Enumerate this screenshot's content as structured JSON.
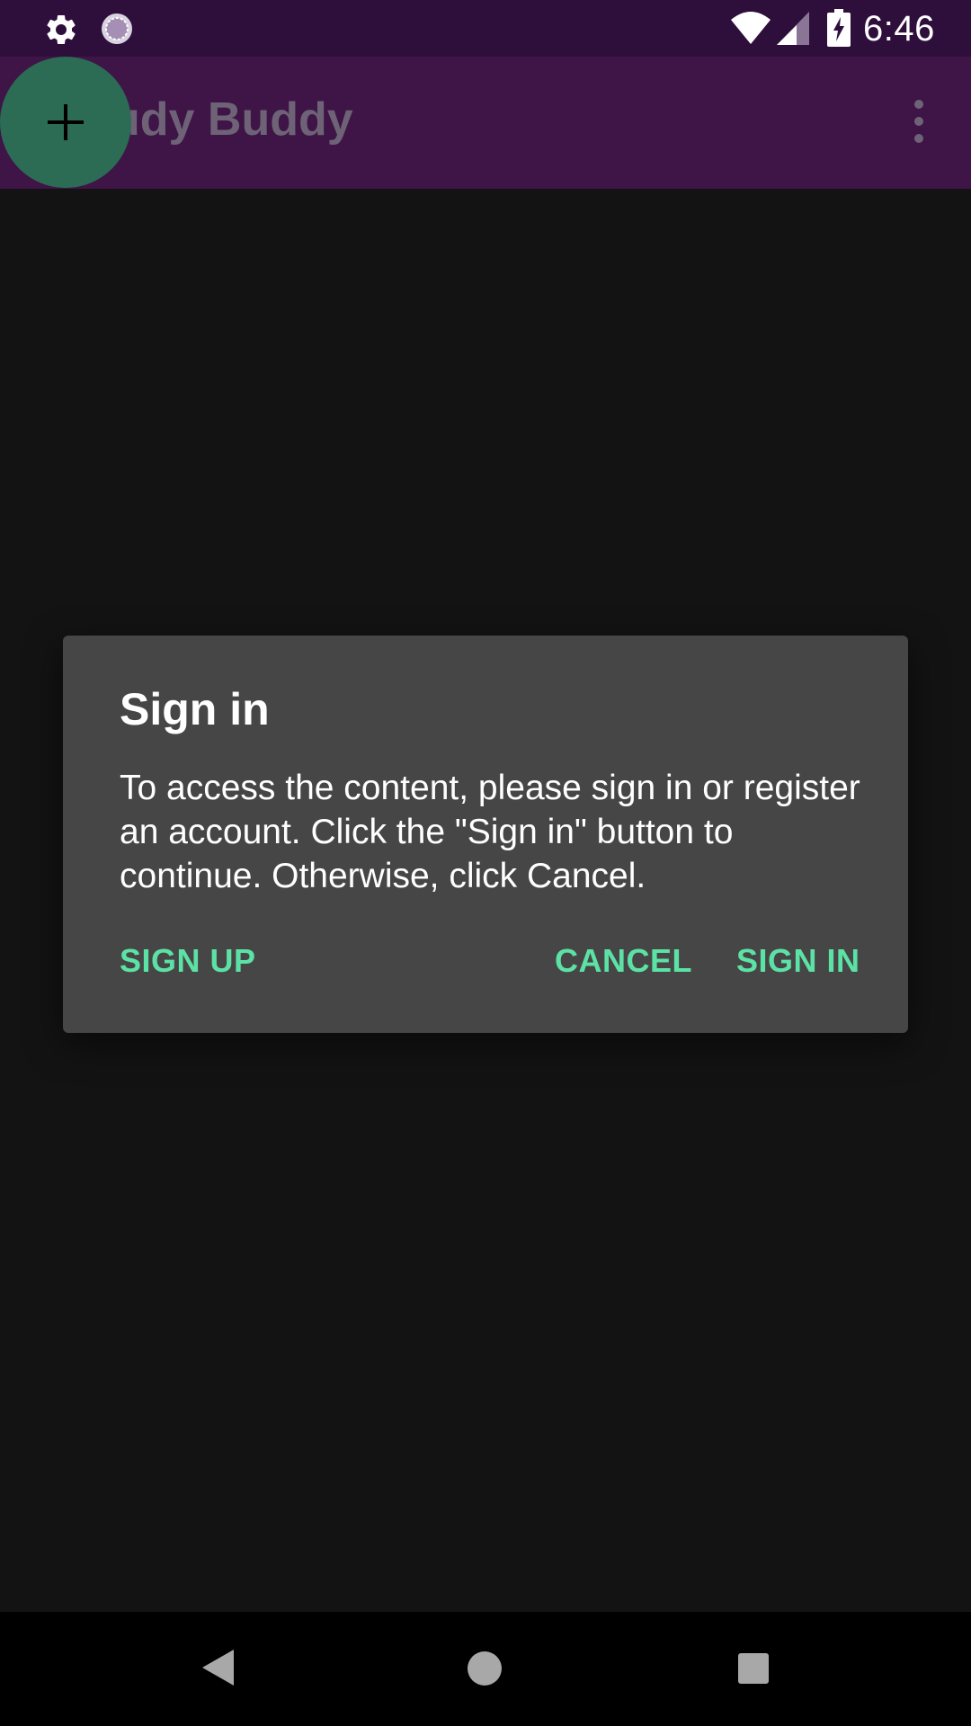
{
  "status_bar": {
    "time": "6:46",
    "icons": [
      "gear-icon",
      "sync-icon",
      "wifi-icon",
      "cell-signal-icon",
      "battery-charging-icon"
    ]
  },
  "app_bar": {
    "title": "Study Buddy",
    "overflow_icon": "more-vert-icon"
  },
  "fab": {
    "icon": "plus-icon",
    "color": "#2c6b54"
  },
  "dialog": {
    "title": "Sign in",
    "message": "To access the content, please sign in or register an account. Click the \"Sign in\" button to continue. Otherwise, click Cancel.",
    "buttons": {
      "sign_up": "SIGN UP",
      "cancel": "CANCEL",
      "sign_in": "SIGN IN"
    },
    "accent_color": "#5ce2a5",
    "background_color": "#464646"
  },
  "nav_bar": {
    "icons": [
      "back-icon",
      "home-icon",
      "recents-icon"
    ]
  },
  "colors": {
    "status_bar": "#2e0f3c",
    "app_bar": "#3f1447",
    "content_background": "#131313"
  }
}
